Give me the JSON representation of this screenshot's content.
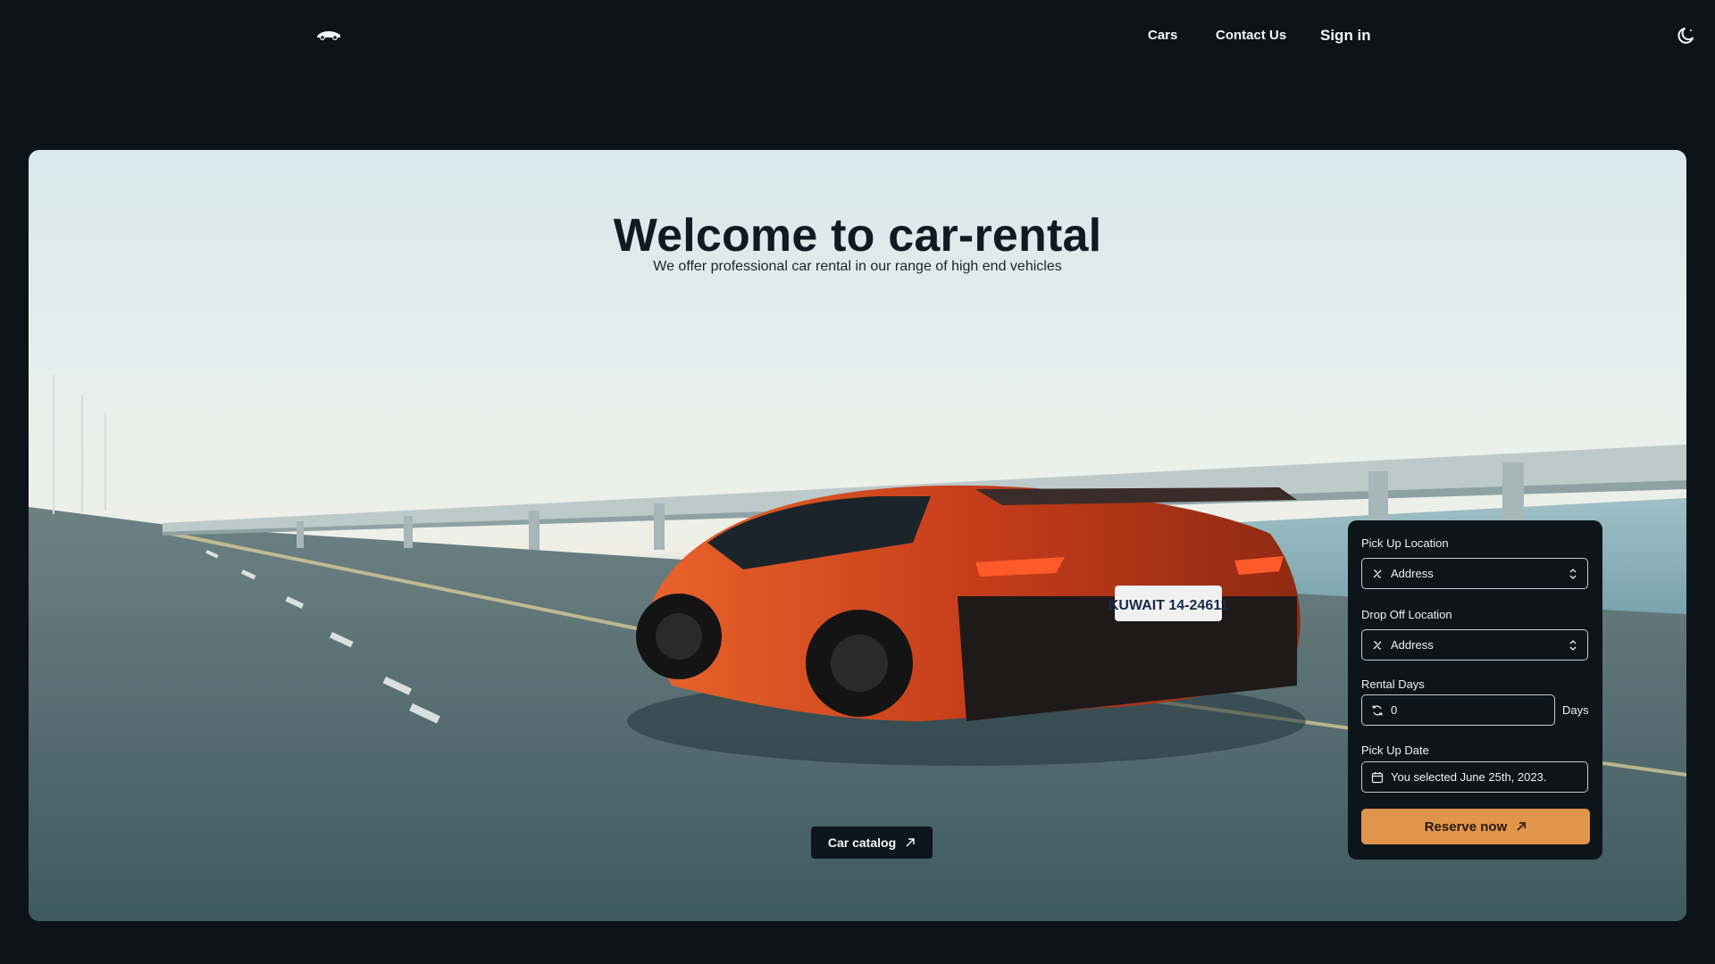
{
  "nav": {
    "logo_icon": "car-icon",
    "links": [
      {
        "label": "Cars"
      },
      {
        "label": "Contact Us"
      }
    ],
    "signin_label": "Sign in",
    "theme_icon": "moon-icon"
  },
  "hero": {
    "title": "Welcome to car-rental",
    "subtitle": "We offer professional car rental in our range of high end vehicles",
    "plate_text": "KUWAIT 14-24611",
    "catalog_button": {
      "label": "Car catalog",
      "icon": "arrow-up-right-icon"
    }
  },
  "reserve_form": {
    "pickup_location": {
      "label": "Pick Up Location",
      "value": "Address",
      "icon": "map-pin-icon"
    },
    "dropoff_location": {
      "label": "Drop Off Location",
      "value": "Address",
      "icon": "map-pin-icon"
    },
    "rental_days": {
      "label": "Rental Days",
      "value": "0",
      "suffix": "Days",
      "icon": "refresh-icon"
    },
    "pickup_date": {
      "label": "Pick Up Date",
      "value": "You selected June 25th, 2023.",
      "icon": "calendar-icon"
    },
    "reserve_button": {
      "label": "Reserve now",
      "icon": "arrow-up-right-icon"
    }
  },
  "colors": {
    "background": "#0c141a",
    "panel": "#0d151b",
    "accent": "#e0954a",
    "car": "#d4471e"
  }
}
